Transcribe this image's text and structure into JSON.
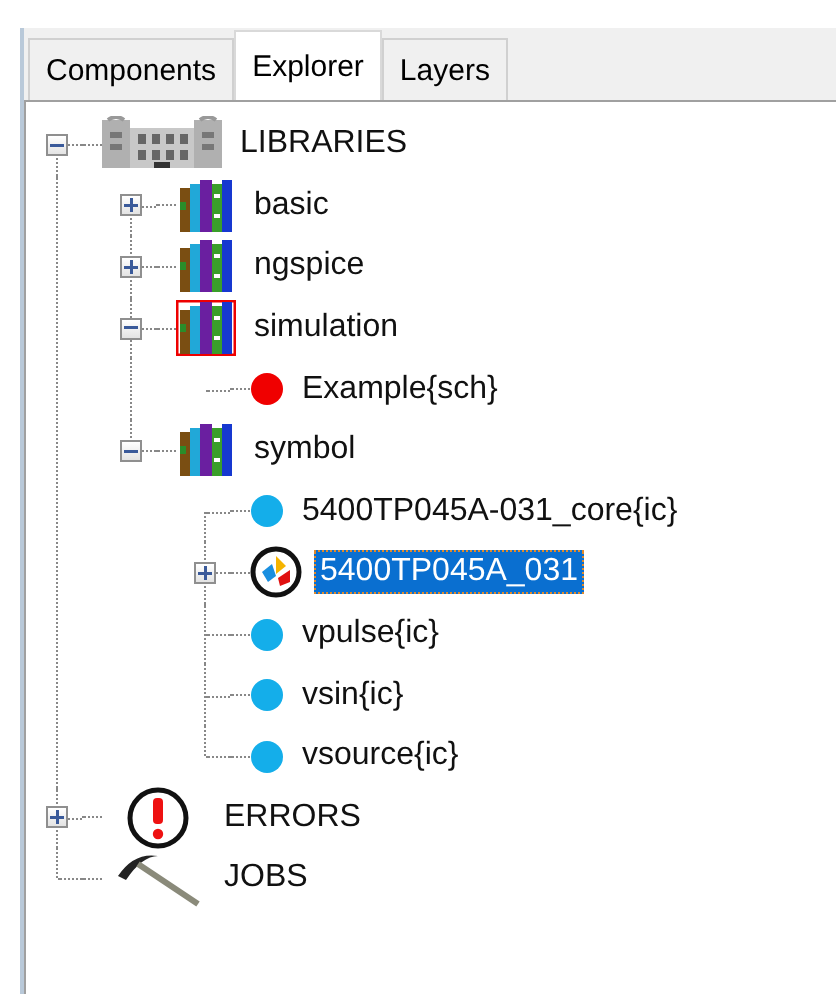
{
  "tabs": [
    {
      "label": "Components",
      "selected": false
    },
    {
      "label": "Explorer",
      "selected": true
    },
    {
      "label": "Layers",
      "selected": false
    }
  ],
  "tree": [
    {
      "label": "LIBRARIES",
      "kind": "libraries",
      "expanded": true,
      "selected": false,
      "children": [
        {
          "label": "basic",
          "kind": "library",
          "expanded": false,
          "selected": false
        },
        {
          "label": "ngspice",
          "kind": "library",
          "expanded": false,
          "selected": false
        },
        {
          "label": "simulation",
          "kind": "library-active",
          "expanded": true,
          "selected": false,
          "children": [
            {
              "label": "Example{sch}",
              "kind": "schematic",
              "selected": false
            }
          ]
        },
        {
          "label": "symbol",
          "kind": "library",
          "expanded": true,
          "selected": false,
          "children": [
            {
              "label": "5400TP045A-031_core{ic}",
              "kind": "ic",
              "selected": false
            },
            {
              "label": "5400TP045A_031",
              "kind": "symbol",
              "expanded": false,
              "selected": true
            },
            {
              "label": "vpulse{ic}",
              "kind": "ic",
              "selected": false
            },
            {
              "label": "vsin{ic}",
              "kind": "ic",
              "selected": false
            },
            {
              "label": "vsource{ic}",
              "kind": "ic",
              "selected": false
            }
          ]
        }
      ]
    },
    {
      "label": "ERRORS",
      "kind": "errors",
      "expanded": false,
      "selected": false
    },
    {
      "label": "JOBS",
      "kind": "jobs",
      "selected": false
    }
  ]
}
